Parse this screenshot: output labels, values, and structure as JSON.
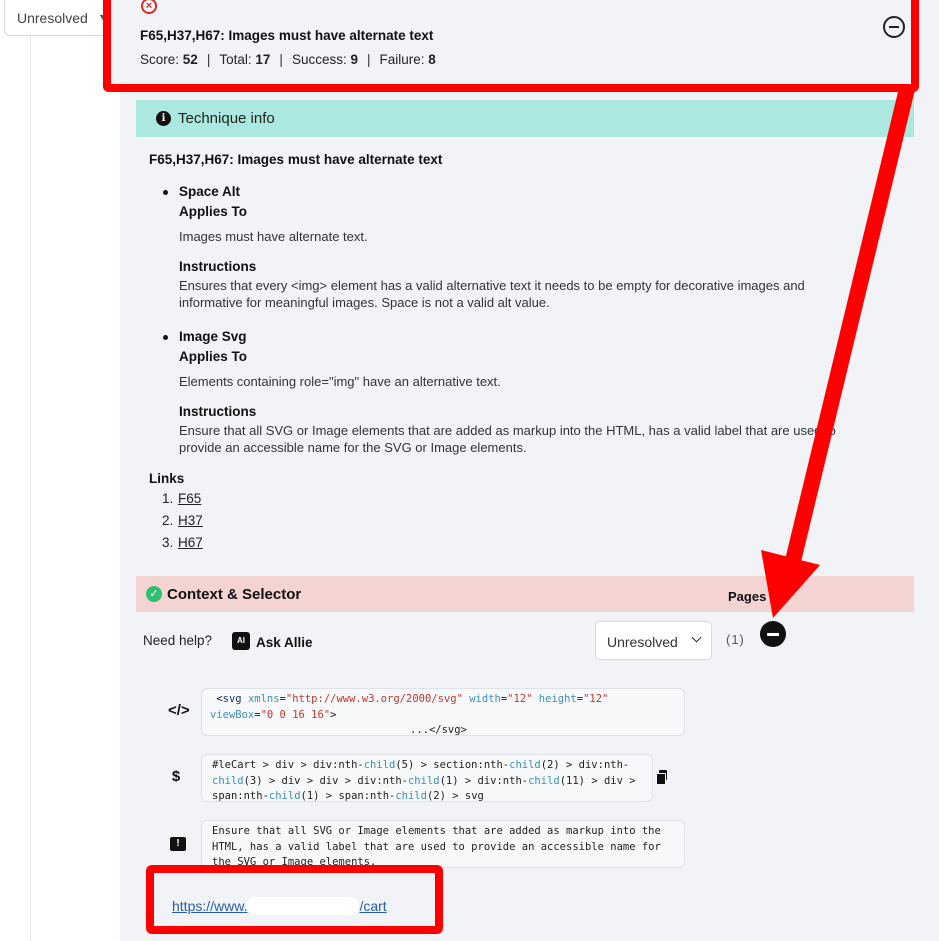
{
  "top_filter": {
    "value": "Unresolved"
  },
  "header": {
    "title": "F65,H37,H67: Images must have alternate text",
    "score_label": "Score:",
    "score": "52",
    "total_label": "Total:",
    "total": "17",
    "success_label": "Success:",
    "success": "9",
    "failure_label": "Failure:",
    "failure": "8",
    "status_icon": "error-circle-icon",
    "collapse_icon": "minus-circle-icon"
  },
  "technique": {
    "bar_label": "Technique info",
    "title": "F65,H37,H67: Images must have alternate text",
    "rules": [
      {
        "name": "Space Alt",
        "applies_heading": "Applies To",
        "applies": "Images must have alternate text.",
        "instructions_heading": "Instructions",
        "instructions": "Ensures that every <img> element has a valid alternative text it needs to be empty for decorative images and informative for meaningful images. Space is not a valid alt value."
      },
      {
        "name": "Image Svg",
        "applies_heading": "Applies To",
        "applies": "Elements containing role=\"img\" have an alternative text.",
        "instructions_heading": "Instructions",
        "instructions": "Ensure that all SVG or Image elements that are added as markup into the HTML, has a valid label that are used to provide an accessible name for the SVG or Image elements."
      }
    ],
    "links_heading": "Links",
    "links": [
      {
        "num": "1.",
        "label": "F65"
      },
      {
        "num": "2.",
        "label": "H37"
      },
      {
        "num": "3.",
        "label": "H67"
      }
    ]
  },
  "context": {
    "bar_label": "Context & Selector",
    "pages_label": "Pages",
    "need_help": "Need help?",
    "ask_label": "Ask Allie",
    "ask_icon_text": "AI",
    "status_value": "Unresolved",
    "page_count": "(1)",
    "code_snippet": {
      "open_tag": "svg",
      "attr1": "xmlns",
      "val1": "\"http://www.w3.org/2000/svg\"",
      "attr2": "width",
      "val2": "\"12\"",
      "attr3": "height",
      "val3": "\"12\"",
      "attr4": "viewBox",
      "val4": "\"0 0 16 16\"",
      "close": "...</svg>"
    },
    "selector_parts": [
      "#leCart > div > div:nth-",
      "child",
      "(5) > section:nth-",
      "child",
      "(2) > div:nth-",
      "child",
      "(3) > div > div > div:nth-",
      "child",
      "(1) > div:nth-",
      "child",
      "(11) > div > span:nth-",
      "child",
      "(1) > span:nth-",
      "child",
      "(2) > svg"
    ],
    "message": "Ensure that all SVG or Image elements that are added as markup into the HTML, has a valid label that are used to provide an accessible name for the SVG or Image elements.",
    "url_prefix": "https://www.",
    "url_suffix": "/cart",
    "code_icon": "code-icon",
    "selector_icon": "dollar-icon",
    "message_icon": "message-alert-icon",
    "copy_icon": "copy-icon"
  },
  "annotation_color": "#ff0000"
}
